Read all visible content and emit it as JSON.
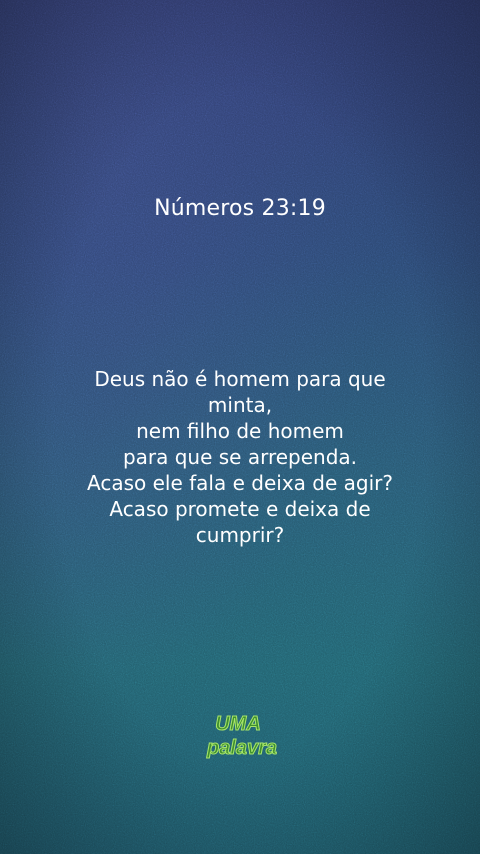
{
  "reference": "Números 23:19",
  "verse_lines": [
    "Deus não é homem para que",
    "minta,",
    "nem filho de homem",
    "para que se arrependa.",
    "Acaso ele fala e deixa de agir?",
    "Acaso promete e deixa de",
    "cumprir?"
  ],
  "logo": {
    "line1": "UMA",
    "line2": "palavra",
    "fill_color": "#3f8f2e",
    "outline_color": "#a8e66a"
  },
  "colors": {
    "background_top": "#2e3a6c",
    "background_bottom": "#1f5566",
    "text": "#ffffff"
  }
}
